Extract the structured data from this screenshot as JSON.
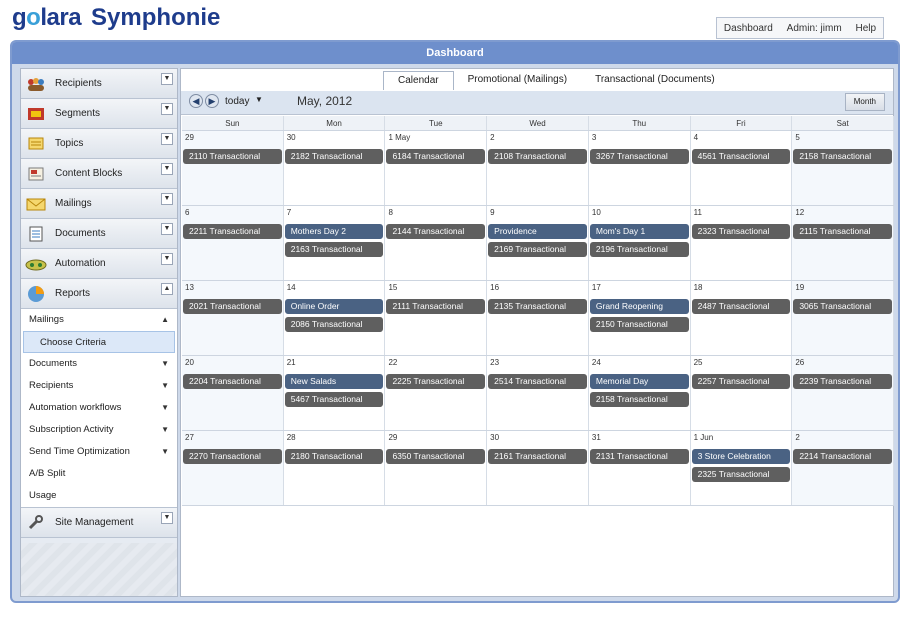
{
  "brand": {
    "company_pre": "g",
    "company_o": "o",
    "company_post": "lara",
    "product": "Symphonie"
  },
  "top_nav": {
    "dashboard": "Dashboard",
    "admin": "Admin: jimm",
    "help": "Help"
  },
  "title": "Dashboard",
  "sidebar": {
    "items": [
      {
        "label": "Recipients",
        "icon": "people-icon"
      },
      {
        "label": "Segments",
        "icon": "segments-icon"
      },
      {
        "label": "Topics",
        "icon": "topics-icon"
      },
      {
        "label": "Content Blocks",
        "icon": "content-blocks-icon"
      },
      {
        "label": "Mailings",
        "icon": "envelope-icon"
      },
      {
        "label": "Documents",
        "icon": "document-icon"
      },
      {
        "label": "Automation",
        "icon": "automation-icon"
      },
      {
        "label": "Reports",
        "icon": "reports-icon"
      }
    ],
    "reports_sub": [
      "Mailings",
      "Choose Criteria",
      "Documents",
      "Recipients",
      "Automation workflows",
      "Subscription Activity",
      "Send Time Optimization",
      "A/B Split",
      "Usage"
    ],
    "site_management": "Site Management"
  },
  "tabs": {
    "calendar": "Calendar",
    "promotional": "Promotional (Mailings)",
    "transactional": "Transactional (Documents)"
  },
  "toolbar": {
    "today": "today",
    "month_title": "May, 2012",
    "view": "Month"
  },
  "calendar": {
    "dow": [
      "Sun",
      "Mon",
      "Tue",
      "Wed",
      "Thu",
      "Fri",
      "Sat"
    ],
    "weeks": [
      [
        {
          "num": "29",
          "events": [
            {
              "text": "2110 Transactional",
              "kind": "gray"
            }
          ]
        },
        {
          "num": "30",
          "events": [
            {
              "text": "2182 Transactional",
              "kind": "gray"
            }
          ]
        },
        {
          "num": "1 May",
          "events": [
            {
              "text": "6184 Transactional",
              "kind": "gray"
            }
          ]
        },
        {
          "num": "2",
          "events": [
            {
              "text": "2108 Transactional",
              "kind": "gray"
            }
          ]
        },
        {
          "num": "3",
          "events": [
            {
              "text": "3267 Transactional",
              "kind": "gray"
            }
          ]
        },
        {
          "num": "4",
          "events": [
            {
              "text": "4561 Transactional",
              "kind": "gray"
            }
          ]
        },
        {
          "num": "5",
          "events": [
            {
              "text": "2158 Transactional",
              "kind": "gray"
            }
          ]
        }
      ],
      [
        {
          "num": "6",
          "events": [
            {
              "text": "2211 Transactional",
              "kind": "gray"
            }
          ]
        },
        {
          "num": "7",
          "events": [
            {
              "text": "Mothers Day 2",
              "kind": "blue"
            },
            {
              "text": "2163 Transactional",
              "kind": "gray"
            }
          ]
        },
        {
          "num": "8",
          "events": [
            {
              "text": "2144 Transactional",
              "kind": "gray"
            }
          ]
        },
        {
          "num": "9",
          "events": [
            {
              "text": "Providence",
              "kind": "blue"
            },
            {
              "text": "2169 Transactional",
              "kind": "gray"
            }
          ]
        },
        {
          "num": "10",
          "events": [
            {
              "text": "Mom's Day 1",
              "kind": "blue"
            },
            {
              "text": "2196 Transactional",
              "kind": "gray"
            }
          ]
        },
        {
          "num": "11",
          "events": [
            {
              "text": "2323 Transactional",
              "kind": "gray"
            }
          ]
        },
        {
          "num": "12",
          "events": [
            {
              "text": "2115 Transactional",
              "kind": "gray"
            }
          ]
        }
      ],
      [
        {
          "num": "13",
          "events": [
            {
              "text": "2021 Transactional",
              "kind": "gray"
            }
          ]
        },
        {
          "num": "14",
          "events": [
            {
              "text": "Online Order",
              "kind": "blue"
            },
            {
              "text": "2086 Transactional",
              "kind": "gray"
            }
          ]
        },
        {
          "num": "15",
          "events": [
            {
              "text": "2111 Transactional",
              "kind": "gray"
            }
          ]
        },
        {
          "num": "16",
          "events": [
            {
              "text": "2135 Transactional",
              "kind": "gray"
            }
          ]
        },
        {
          "num": "17",
          "events": [
            {
              "text": "Grand Reopening",
              "kind": "blue"
            },
            {
              "text": "2150 Transactional",
              "kind": "gray"
            }
          ]
        },
        {
          "num": "18",
          "events": [
            {
              "text": "2487 Transactional",
              "kind": "gray"
            }
          ]
        },
        {
          "num": "19",
          "events": [
            {
              "text": "3065 Transactional",
              "kind": "gray"
            }
          ]
        }
      ],
      [
        {
          "num": "20",
          "events": [
            {
              "text": "2204 Transactional",
              "kind": "gray"
            }
          ]
        },
        {
          "num": "21",
          "events": [
            {
              "text": "New Salads",
              "kind": "blue"
            },
            {
              "text": "5467 Transactional",
              "kind": "gray"
            }
          ]
        },
        {
          "num": "22",
          "events": [
            {
              "text": "2225 Transactional",
              "kind": "gray"
            }
          ]
        },
        {
          "num": "23",
          "events": [
            {
              "text": "2514 Transactional",
              "kind": "gray"
            }
          ]
        },
        {
          "num": "24",
          "events": [
            {
              "text": "Memorial Day",
              "kind": "blue"
            },
            {
              "text": "2158 Transactional",
              "kind": "gray"
            }
          ]
        },
        {
          "num": "25",
          "events": [
            {
              "text": "2257 Transactional",
              "kind": "gray"
            }
          ]
        },
        {
          "num": "26",
          "events": [
            {
              "text": "2239 Transactional",
              "kind": "gray"
            }
          ]
        }
      ],
      [
        {
          "num": "27",
          "events": [
            {
              "text": "2270 Transactional",
              "kind": "gray"
            }
          ]
        },
        {
          "num": "28",
          "events": [
            {
              "text": "2180 Transactional",
              "kind": "gray"
            }
          ]
        },
        {
          "num": "29",
          "events": [
            {
              "text": "6350 Transactional",
              "kind": "gray"
            }
          ]
        },
        {
          "num": "30",
          "events": [
            {
              "text": "2161 Transactional",
              "kind": "gray"
            }
          ]
        },
        {
          "num": "31",
          "events": [
            {
              "text": "2131 Transactional",
              "kind": "gray"
            }
          ]
        },
        {
          "num": "1 Jun",
          "events": [
            {
              "text": "3 Store Celebration",
              "kind": "blue"
            },
            {
              "text": "2325 Transactional",
              "kind": "gray"
            }
          ]
        },
        {
          "num": "2",
          "events": [
            {
              "text": "2214 Transactional",
              "kind": "gray"
            }
          ]
        }
      ]
    ]
  },
  "colors": {
    "event_gray": "#5f5f5f",
    "event_blue": "#4a6283",
    "titlebar": "#6e8fcc",
    "frame": "#ced9ea"
  }
}
